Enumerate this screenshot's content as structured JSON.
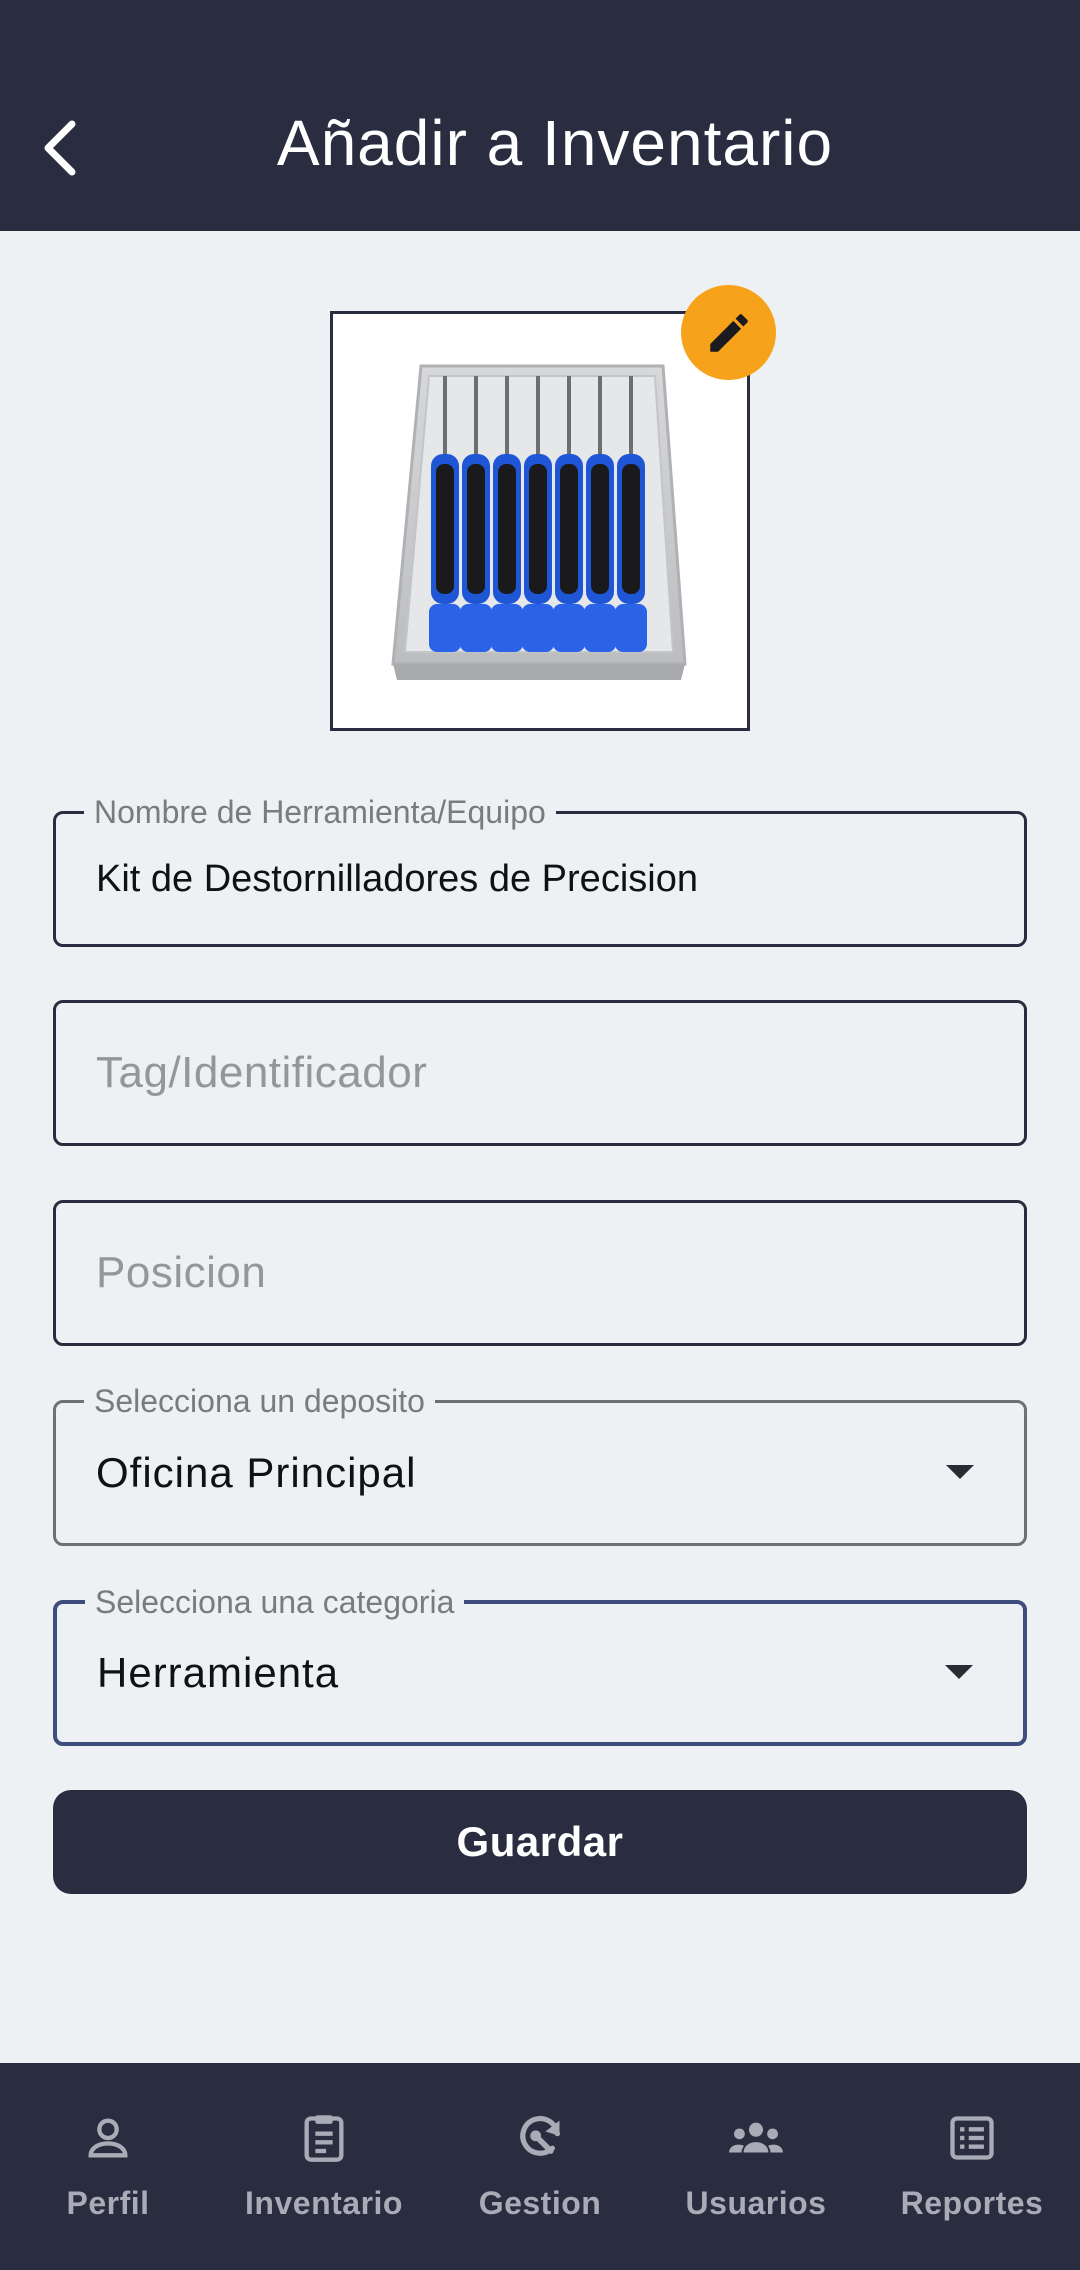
{
  "app_bar": {
    "title": "Añadir a Inventario",
    "back_icon": "chevron-left-icon"
  },
  "photo": {
    "alt": "Kit de destornilladores de precisión",
    "edit_icon": "pencil-icon"
  },
  "form": {
    "name": {
      "label": "Nombre de Herramienta/Equipo",
      "value": "Kit de Destornilladores de Precision"
    },
    "tag": {
      "placeholder": "Tag/Identificador",
      "value": ""
    },
    "position": {
      "placeholder": "Posicion",
      "value": ""
    },
    "deposit": {
      "label": "Selecciona un deposito",
      "value": "Oficina Principal"
    },
    "category": {
      "label": "Selecciona una categoria",
      "value": "Herramienta"
    },
    "save_label": "Guardar"
  },
  "bottom_nav": {
    "items": [
      {
        "label": "Perfil",
        "icon": "person-icon"
      },
      {
        "label": "Inventario",
        "icon": "clipboard-icon"
      },
      {
        "label": "Gestion",
        "icon": "tools-sync-icon"
      },
      {
        "label": "Usuarios",
        "icon": "group-icon"
      },
      {
        "label": "Reportes",
        "icon": "list-report-icon"
      }
    ]
  },
  "colors": {
    "primary": "#2a2c3f",
    "background": "#edf1f3",
    "accent": "#f7a21b",
    "focus": "#3e4d7e",
    "nav_inactive": "#a9abb6"
  }
}
